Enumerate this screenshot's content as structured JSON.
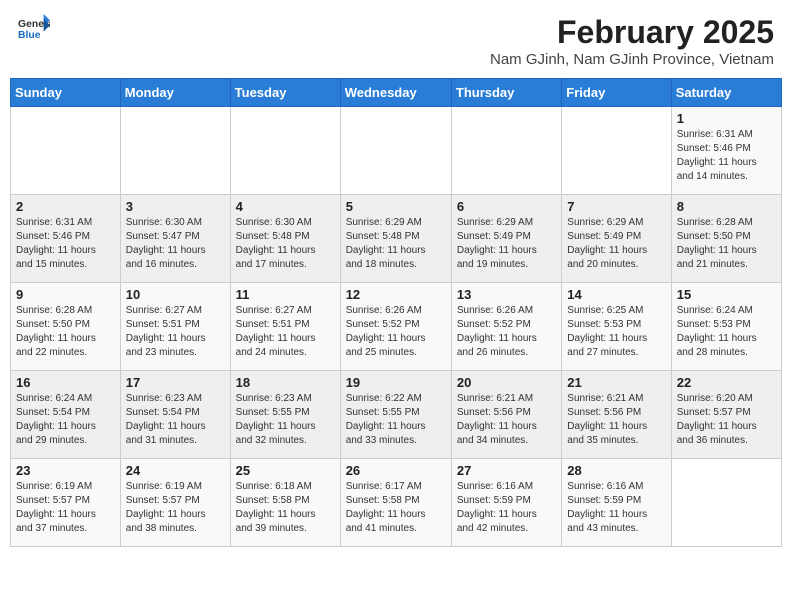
{
  "logo": {
    "line1": "General",
    "line2": "Blue"
  },
  "title": "February 2025",
  "location": "Nam GJinh, Nam GJinh Province, Vietnam",
  "days_of_week": [
    "Sunday",
    "Monday",
    "Tuesday",
    "Wednesday",
    "Thursday",
    "Friday",
    "Saturday"
  ],
  "weeks": [
    [
      {
        "day": "",
        "info": ""
      },
      {
        "day": "",
        "info": ""
      },
      {
        "day": "",
        "info": ""
      },
      {
        "day": "",
        "info": ""
      },
      {
        "day": "",
        "info": ""
      },
      {
        "day": "",
        "info": ""
      },
      {
        "day": "1",
        "info": "Sunrise: 6:31 AM\nSunset: 5:46 PM\nDaylight: 11 hours\nand 14 minutes."
      }
    ],
    [
      {
        "day": "2",
        "info": "Sunrise: 6:31 AM\nSunset: 5:46 PM\nDaylight: 11 hours\nand 15 minutes."
      },
      {
        "day": "3",
        "info": "Sunrise: 6:30 AM\nSunset: 5:47 PM\nDaylight: 11 hours\nand 16 minutes."
      },
      {
        "day": "4",
        "info": "Sunrise: 6:30 AM\nSunset: 5:48 PM\nDaylight: 11 hours\nand 17 minutes."
      },
      {
        "day": "5",
        "info": "Sunrise: 6:29 AM\nSunset: 5:48 PM\nDaylight: 11 hours\nand 18 minutes."
      },
      {
        "day": "6",
        "info": "Sunrise: 6:29 AM\nSunset: 5:49 PM\nDaylight: 11 hours\nand 19 minutes."
      },
      {
        "day": "7",
        "info": "Sunrise: 6:29 AM\nSunset: 5:49 PM\nDaylight: 11 hours\nand 20 minutes."
      },
      {
        "day": "8",
        "info": "Sunrise: 6:28 AM\nSunset: 5:50 PM\nDaylight: 11 hours\nand 21 minutes."
      }
    ],
    [
      {
        "day": "9",
        "info": "Sunrise: 6:28 AM\nSunset: 5:50 PM\nDaylight: 11 hours\nand 22 minutes."
      },
      {
        "day": "10",
        "info": "Sunrise: 6:27 AM\nSunset: 5:51 PM\nDaylight: 11 hours\nand 23 minutes."
      },
      {
        "day": "11",
        "info": "Sunrise: 6:27 AM\nSunset: 5:51 PM\nDaylight: 11 hours\nand 24 minutes."
      },
      {
        "day": "12",
        "info": "Sunrise: 6:26 AM\nSunset: 5:52 PM\nDaylight: 11 hours\nand 25 minutes."
      },
      {
        "day": "13",
        "info": "Sunrise: 6:26 AM\nSunset: 5:52 PM\nDaylight: 11 hours\nand 26 minutes."
      },
      {
        "day": "14",
        "info": "Sunrise: 6:25 AM\nSunset: 5:53 PM\nDaylight: 11 hours\nand 27 minutes."
      },
      {
        "day": "15",
        "info": "Sunrise: 6:24 AM\nSunset: 5:53 PM\nDaylight: 11 hours\nand 28 minutes."
      }
    ],
    [
      {
        "day": "16",
        "info": "Sunrise: 6:24 AM\nSunset: 5:54 PM\nDaylight: 11 hours\nand 29 minutes."
      },
      {
        "day": "17",
        "info": "Sunrise: 6:23 AM\nSunset: 5:54 PM\nDaylight: 11 hours\nand 31 minutes."
      },
      {
        "day": "18",
        "info": "Sunrise: 6:23 AM\nSunset: 5:55 PM\nDaylight: 11 hours\nand 32 minutes."
      },
      {
        "day": "19",
        "info": "Sunrise: 6:22 AM\nSunset: 5:55 PM\nDaylight: 11 hours\nand 33 minutes."
      },
      {
        "day": "20",
        "info": "Sunrise: 6:21 AM\nSunset: 5:56 PM\nDaylight: 11 hours\nand 34 minutes."
      },
      {
        "day": "21",
        "info": "Sunrise: 6:21 AM\nSunset: 5:56 PM\nDaylight: 11 hours\nand 35 minutes."
      },
      {
        "day": "22",
        "info": "Sunrise: 6:20 AM\nSunset: 5:57 PM\nDaylight: 11 hours\nand 36 minutes."
      }
    ],
    [
      {
        "day": "23",
        "info": "Sunrise: 6:19 AM\nSunset: 5:57 PM\nDaylight: 11 hours\nand 37 minutes."
      },
      {
        "day": "24",
        "info": "Sunrise: 6:19 AM\nSunset: 5:57 PM\nDaylight: 11 hours\nand 38 minutes."
      },
      {
        "day": "25",
        "info": "Sunrise: 6:18 AM\nSunset: 5:58 PM\nDaylight: 11 hours\nand 39 minutes."
      },
      {
        "day": "26",
        "info": "Sunrise: 6:17 AM\nSunset: 5:58 PM\nDaylight: 11 hours\nand 41 minutes."
      },
      {
        "day": "27",
        "info": "Sunrise: 6:16 AM\nSunset: 5:59 PM\nDaylight: 11 hours\nand 42 minutes."
      },
      {
        "day": "28",
        "info": "Sunrise: 6:16 AM\nSunset: 5:59 PM\nDaylight: 11 hours\nand 43 minutes."
      },
      {
        "day": "",
        "info": ""
      }
    ]
  ]
}
